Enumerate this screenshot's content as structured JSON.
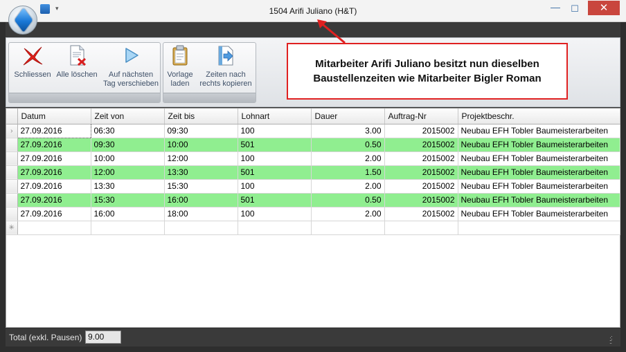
{
  "window": {
    "title": "1504 Arifi Juliano (H&T)",
    "qat_dropdown_glyph": "▾",
    "minimize_glyph": "—",
    "maximize_glyph": "☐",
    "close_glyph": "✕",
    "close_color": "#c9463d"
  },
  "ribbon": {
    "buttons": {
      "schliessen": {
        "label": "Schliessen",
        "icon": "close-x-icon"
      },
      "alle_loeschen": {
        "label": "Alle löschen",
        "icon": "delete-document-icon"
      },
      "auf_naechsten": {
        "label1": "Auf nächsten",
        "label2": "Tag verschieben",
        "icon": "play-arrow-icon"
      },
      "vorlage": {
        "label1": "Vorlage",
        "label2": "laden",
        "icon": "clipboard-icon"
      },
      "zeiten_kopieren": {
        "label1": "Zeiten nach",
        "label2": "rechts kopieren",
        "icon": "copy-right-icon"
      }
    }
  },
  "callout": {
    "line1": "Mitarbeiter Arifi Juliano besitzt nun dieselben",
    "line2": "Baustellenzeiten wie Mitarbeiter Bigler Roman",
    "border_color": "#e02020"
  },
  "grid": {
    "columns": {
      "datum": "Datum",
      "zeit_von": "Zeit von",
      "zeit_bis": "Zeit bis",
      "lohnart": "Lohnart",
      "dauer": "Dauer",
      "auftrag": "Auftrag-Nr",
      "projekt": "Projektbeschr."
    },
    "highlight_color": "#90ee90",
    "current_row_glyph": "›",
    "new_row_glyph": "✳",
    "rows": [
      {
        "datum": "27.09.2016",
        "von": "06:30",
        "bis": "09:30",
        "lohnart": "100",
        "dauer": "3.00",
        "auftrag": "2015002",
        "projekt": "Neubau EFH Tobler Baumeisterarbeiten",
        "highlight": false
      },
      {
        "datum": "27.09.2016",
        "von": "09:30",
        "bis": "10:00",
        "lohnart": "501",
        "dauer": "0.50",
        "auftrag": "2015002",
        "projekt": "Neubau EFH Tobler Baumeisterarbeiten",
        "highlight": true
      },
      {
        "datum": "27.09.2016",
        "von": "10:00",
        "bis": "12:00",
        "lohnart": "100",
        "dauer": "2.00",
        "auftrag": "2015002",
        "projekt": "Neubau EFH Tobler Baumeisterarbeiten",
        "highlight": false
      },
      {
        "datum": "27.09.2016",
        "von": "12:00",
        "bis": "13:30",
        "lohnart": "501",
        "dauer": "1.50",
        "auftrag": "2015002",
        "projekt": "Neubau EFH Tobler Baumeisterarbeiten",
        "highlight": true
      },
      {
        "datum": "27.09.2016",
        "von": "13:30",
        "bis": "15:30",
        "lohnart": "100",
        "dauer": "2.00",
        "auftrag": "2015002",
        "projekt": "Neubau EFH Tobler Baumeisterarbeiten",
        "highlight": false
      },
      {
        "datum": "27.09.2016",
        "von": "15:30",
        "bis": "16:00",
        "lohnart": "501",
        "dauer": "0.50",
        "auftrag": "2015002",
        "projekt": "Neubau EFH Tobler Baumeisterarbeiten",
        "highlight": true
      },
      {
        "datum": "27.09.2016",
        "von": "16:00",
        "bis": "18:00",
        "lohnart": "100",
        "dauer": "2.00",
        "auftrag": "2015002",
        "projekt": "Neubau EFH Tobler Baumeisterarbeiten",
        "highlight": false
      }
    ]
  },
  "status": {
    "total_label": "Total (exkl. Pausen)",
    "total_value": "9.00"
  }
}
